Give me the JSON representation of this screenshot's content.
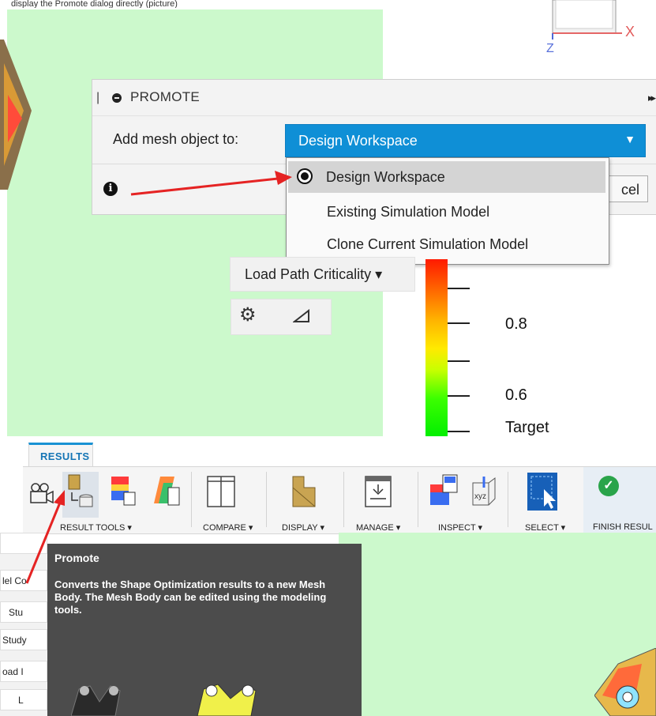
{
  "caption": "display the Promote dialog directly (picture)",
  "dialog": {
    "title": "PROMOTE",
    "add_label": "Add mesh object to:",
    "selected_value": "Design Workspace",
    "cancel_label": "cel",
    "menu_items": [
      "Design Workspace",
      "Existing Simulation Model",
      "Clone Current Simulation Model"
    ]
  },
  "load_path": {
    "label": "Load Path Criticality ▾"
  },
  "legend": {
    "values": [
      "0.8",
      "0.6",
      "Target"
    ]
  },
  "axes": {
    "x_label": "X",
    "z_label": "Z"
  },
  "ribbon": {
    "tab": "RESULTS",
    "groups": [
      "RESULT TOOLS ▾",
      "COMPARE ▾",
      "DISPLAY ▾",
      "MANAGE ▾",
      "INSPECT ▾",
      "SELECT ▾",
      "FINISH RESUL"
    ]
  },
  "browser": {
    "rows": [
      "lel Co",
      "Stu",
      "Study",
      "oad I",
      "L"
    ]
  },
  "tooltip": {
    "title": "Promote",
    "description": "Converts the Shape Optimization results to a new Mesh Body. The Mesh Body can be edited using the modeling tools."
  },
  "colors": {
    "accent": "#0f8fd6",
    "viewport": "#ccf9cc",
    "tooltip_bg": "#4c4c4c",
    "arrow": "#e52323",
    "finish": "#2aa44a"
  }
}
